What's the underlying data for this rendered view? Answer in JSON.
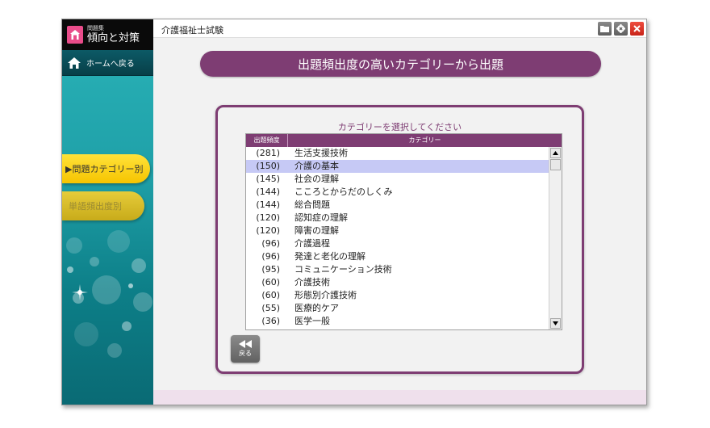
{
  "window": {
    "title": "介護福祉士試験"
  },
  "logo": {
    "sub": "問題集",
    "main": "傾向と対策",
    "icon": "house-icon"
  },
  "sidebar": {
    "home_label": "ホームへ戻る",
    "nav_category": "▶問題カテゴリー別",
    "nav_word": "単語頻出度別"
  },
  "banner": {
    "text": "出題頻出度の高いカテゴリーから出題"
  },
  "panel": {
    "title": "カテゴリーを選択してください",
    "columns": {
      "freq": "出題頻度",
      "category": "カテゴリー"
    },
    "rows": [
      {
        "freq": "(281)",
        "category": "生活支援技術",
        "selected": false
      },
      {
        "freq": "(150)",
        "category": "介護の基本",
        "selected": true
      },
      {
        "freq": "(145)",
        "category": "社会の理解",
        "selected": false
      },
      {
        "freq": "(144)",
        "category": "こころとからだのしくみ",
        "selected": false
      },
      {
        "freq": "(144)",
        "category": "総合問題",
        "selected": false
      },
      {
        "freq": "(120)",
        "category": "認知症の理解",
        "selected": false
      },
      {
        "freq": "(120)",
        "category": "障害の理解",
        "selected": false
      },
      {
        "freq": "(96)",
        "category": "介護過程",
        "selected": false
      },
      {
        "freq": "(96)",
        "category": "発達と老化の理解",
        "selected": false
      },
      {
        "freq": "(95)",
        "category": "コミュニケーション技術",
        "selected": false
      },
      {
        "freq": "(60)",
        "category": "介護技術",
        "selected": false
      },
      {
        "freq": "(60)",
        "category": "形態別介護技術",
        "selected": false
      },
      {
        "freq": "(55)",
        "category": "医療的ケア",
        "selected": false
      },
      {
        "freq": "(36)",
        "category": "医学一般",
        "selected": false
      }
    ],
    "back_label": "戻る"
  },
  "colors": {
    "accent": "#7e3d73",
    "selected_row": "#c6c9f5",
    "nav_active": "#f6c400",
    "sidebar_teal": "#1fa0a8",
    "close": "#e0342a"
  }
}
